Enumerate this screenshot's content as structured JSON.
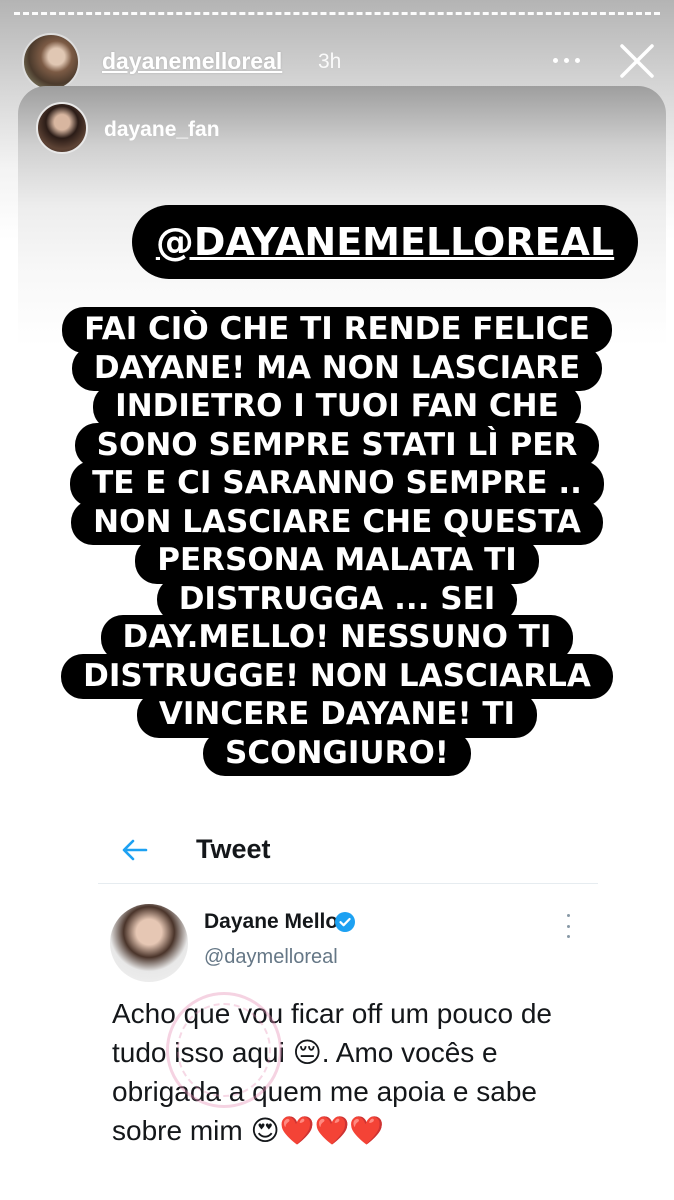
{
  "story": {
    "username": "dayanemelloreal",
    "time": "3h",
    "icons": {
      "more": "more-horizontal-icon",
      "close": "close-icon"
    }
  },
  "repost": {
    "username": "dayane_fan",
    "mention": "@DAYANEMELLOREAL",
    "message_lines": [
      "FAI CIÒ CHE TI RENDE FELICE",
      "DAYANE! MA NON LASCIARE",
      "INDIETRO I TUOI FAN CHE",
      "SONO SEMPRE STATI LÌ PER",
      "TE E CI SARANNO SEMPRE ..",
      "NON LASCIARE CHE QUESTA",
      "PERSONA MALATA TI",
      "DISTRUGGA ... SEI",
      "DAY.MELLO! NESSUNO TI",
      "DISTRUGGE! NON LASCIARLA",
      "VINCERE DAYANE! TI",
      "SCONGIURO!"
    ]
  },
  "tweet": {
    "header_title": "Tweet",
    "author_name": "Dayane Mello",
    "author_handle": "@daymelloreal",
    "text": "Acho que vou ficar off um pouco de tudo isso aqui 😔. Amo vocês e obrigada a quem me apoia e sabe sobre mim 😍❤️❤️❤️",
    "colors": {
      "accent": "#1da1f2",
      "text": "#14171a",
      "muted": "#657786"
    }
  }
}
